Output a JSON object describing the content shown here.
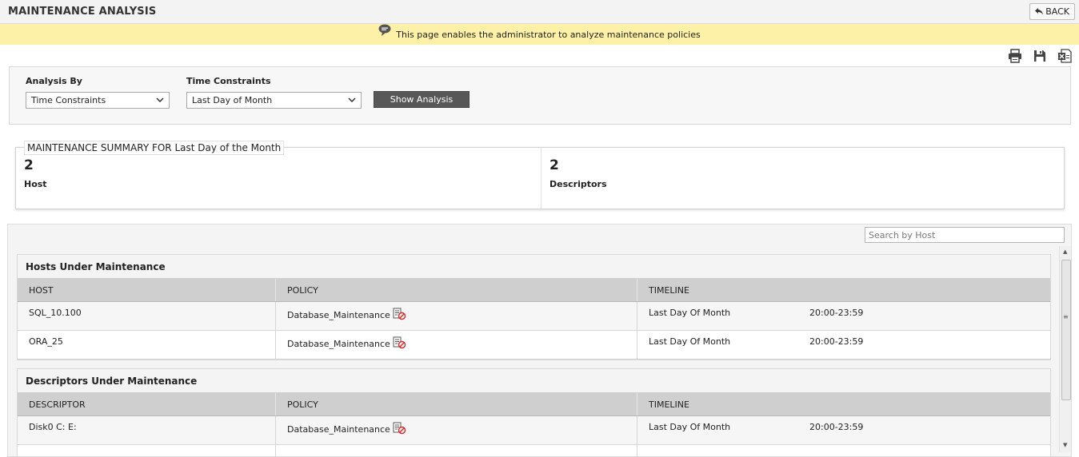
{
  "header": {
    "title": "MAINTENANCE ANALYSIS",
    "back_label": "BACK"
  },
  "info_banner": {
    "text": "This page enables the administrator to analyze maintenance policies"
  },
  "toolbar_icons": [
    "print-icon",
    "save-icon",
    "excel-export-icon"
  ],
  "filters": {
    "analysis_by_label": "Analysis By",
    "analysis_by_value": "Time Constraints",
    "time_constraints_label": "Time Constraints",
    "time_constraints_value": "Last Day of Month",
    "show_button": "Show Analysis"
  },
  "summary": {
    "legend": "MAINTENANCE SUMMARY FOR Last Day of the Month",
    "host_count": "2",
    "host_label": "Host",
    "descriptor_count": "2",
    "descriptor_label": "Descriptors"
  },
  "search": {
    "placeholder": "Search by Host"
  },
  "hosts_section": {
    "title": "Hosts Under Maintenance",
    "columns": [
      "HOST",
      "POLICY",
      "TIMELINE"
    ],
    "rows": [
      {
        "name": "SQL_10.100",
        "policy": "Database_Maintenance",
        "timeline": "Last Day Of Month",
        "time": "20:00-23:59"
      },
      {
        "name": "ORA_25",
        "policy": "Database_Maintenance",
        "timeline": "Last Day Of Month",
        "time": "20:00-23:59"
      }
    ]
  },
  "descriptors_section": {
    "title": "Descriptors Under Maintenance",
    "columns": [
      "DESCRIPTOR",
      "POLICY",
      "TIMELINE"
    ],
    "rows": [
      {
        "name": "Disk0 C: E:",
        "policy": "Database_Maintenance",
        "timeline": "Last Day Of Month",
        "time": "20:00-23:59"
      }
    ]
  }
}
